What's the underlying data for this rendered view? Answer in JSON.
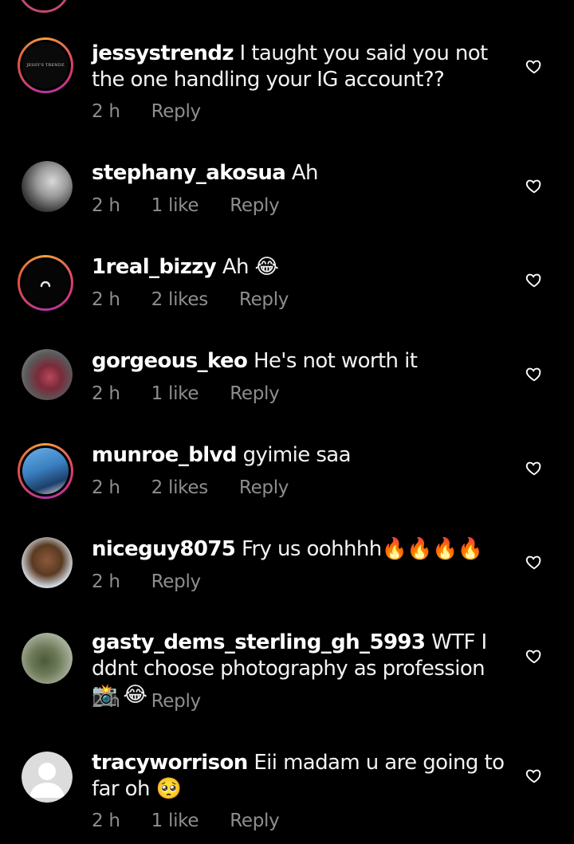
{
  "comments": [
    {
      "username": "jessystrendz",
      "text": "I taught you said you not the one handling your IG account??",
      "time": "2 h",
      "likes": "",
      "reply": "Reply",
      "avatar_text": "JESSY'S TRENDZ"
    },
    {
      "username": "stephany_akosua",
      "text": "Ah",
      "time": "2 h",
      "likes": "1 like",
      "reply": "Reply"
    },
    {
      "username": "1real_bizzy",
      "text": "Ah 😂",
      "time": "2 h",
      "likes": "2 likes",
      "reply": "Reply"
    },
    {
      "username": "gorgeous_keo",
      "text": "He's not worth it",
      "time": "2 h",
      "likes": "1 like",
      "reply": "Reply"
    },
    {
      "username": "munroe_blvd",
      "text": "gyimie saa",
      "time": "2 h",
      "likes": "2 likes",
      "reply": "Reply"
    },
    {
      "username": "niceguy8075",
      "text": "Fry us oohhhh🔥🔥🔥🔥",
      "time": "2 h",
      "likes": "",
      "reply": "Reply"
    },
    {
      "username": "gasty_dems_sterling_gh_5993",
      "text": "WTF I ddnt choose photography as profession 📸 😂",
      "time": "2 h",
      "likes": "",
      "reply": "Reply"
    },
    {
      "username": "tracyworrison",
      "text": "Eii madam u are going to far oh 🥺",
      "time": "2 h",
      "likes": "1 like",
      "reply": "Reply"
    }
  ],
  "colors": {
    "background": "#000000",
    "meta_text": "#8e8e8e",
    "story_ring_start": "#f3a03a",
    "story_ring_end": "#b234a5"
  },
  "icons": {
    "like": "heart-outline-icon"
  }
}
